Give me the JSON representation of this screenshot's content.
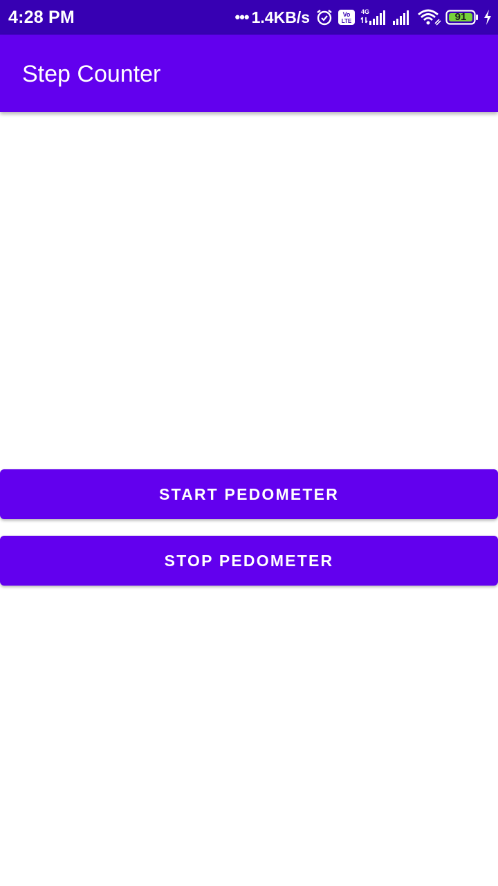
{
  "status_bar": {
    "time": "4:28 PM",
    "network_speed": "1.4KB/s",
    "battery_level": "91",
    "icons": [
      "alarm-icon",
      "volte-icon",
      "signal-4g-icon",
      "signal-icon",
      "wifi-icon",
      "battery-icon",
      "charging-icon"
    ]
  },
  "app_bar": {
    "title": "Step Counter"
  },
  "buttons": {
    "start_label": "START PEDOMETER",
    "stop_label": "STOP PEDOMETER"
  },
  "colors": {
    "status_bar": "#3700b3",
    "primary": "#6200ee",
    "background": "#ffffff",
    "battery_fill": "#76d23a"
  }
}
